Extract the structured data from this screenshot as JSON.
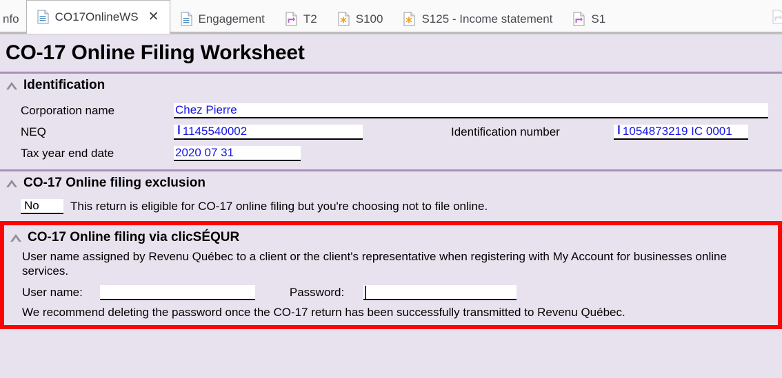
{
  "tabs": [
    {
      "label": "nfo",
      "icon": "document-icon",
      "icon_kind": "none",
      "active": false,
      "partial": true,
      "closable": false
    },
    {
      "label": "CO17OnlineWS",
      "icon": "document-lines-icon",
      "icon_kind": "lines",
      "active": true,
      "partial": false,
      "closable": true,
      "close_glyph": "✕"
    },
    {
      "label": "Engagement",
      "icon": "document-lines-icon",
      "icon_kind": "lines",
      "active": false,
      "partial": false,
      "closable": false
    },
    {
      "label": "T2",
      "icon": "document-arrow-icon",
      "icon_kind": "arrow",
      "active": false,
      "partial": false,
      "closable": false
    },
    {
      "label": "S100",
      "icon": "document-asterisk-icon",
      "icon_kind": "asterisk",
      "active": false,
      "partial": false,
      "closable": false
    },
    {
      "label": "S125 - Income statement",
      "icon": "document-asterisk-icon",
      "icon_kind": "asterisk",
      "active": false,
      "partial": false,
      "closable": false
    },
    {
      "label": "S1",
      "icon": "document-arrow-icon",
      "icon_kind": "arrow",
      "active": false,
      "partial": false,
      "closable": false
    }
  ],
  "page_title": "CO-17 Online Filing Worksheet",
  "sections": {
    "identification": {
      "heading": "Identification",
      "fields": {
        "corporation_name_label": "Corporation name",
        "corporation_name_value": "Chez Pierre",
        "neq_label": "NEQ",
        "neq_value": "1145540002",
        "neq_marker": "❙",
        "identification_number_label": "Identification number",
        "identification_number_value": "1054873219 IC 0001",
        "identification_number_marker": "❙",
        "tax_year_end_date_label": "Tax year end date",
        "tax_year_end_date_value": "2020 07 31"
      }
    },
    "exclusion": {
      "heading": "CO-17 Online filing exclusion",
      "value": "No",
      "text": "This return is eligible for CO-17 online filing but you're choosing not to file online."
    },
    "clicsequr": {
      "heading": "CO-17 Online filing via clicSÉQUR",
      "description": "User name assigned by Revenu Québec to a client or the client's representative when registering with My Account for businesses online services.",
      "user_name_label": "User name:",
      "user_name_value": "",
      "password_label": "Password:",
      "password_value": "",
      "note": "We recommend deleting the password once the CO-17 return has been successfully transmitted to Revenu Québec."
    }
  },
  "colors": {
    "page_background": "#e8e2ef",
    "divider": "#a890bb",
    "highlight_border": "#fb0404",
    "field_value_text": "#1414e6",
    "tab_bar_background": "#fafafa"
  }
}
